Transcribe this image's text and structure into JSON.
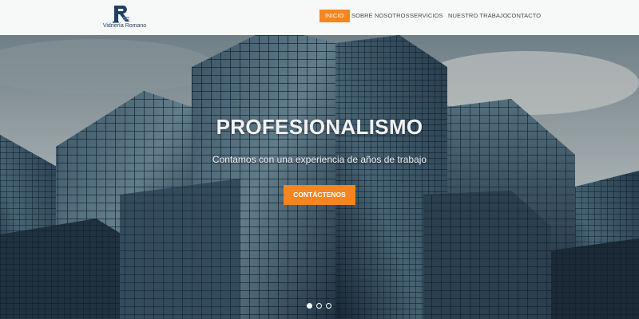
{
  "brand": {
    "logo_name": "Vidriería Romano",
    "logo_mark": "R"
  },
  "nav": {
    "items": [
      {
        "label": "INICIO",
        "active": true
      },
      {
        "label": "SOBRE NOSOTROS",
        "active": false
      },
      {
        "label": "SERVICIOS",
        "active": false
      },
      {
        "label": "NUESTRO TRABAJO",
        "active": false
      },
      {
        "label": "CONTACTO",
        "active": false
      }
    ]
  },
  "hero": {
    "title": "PROFESIONALISMO",
    "subtitle": "Contamos con una experiencia de años de trabajo",
    "button_label": "CONTÁCTENOS",
    "slides_total": 3,
    "active_slide": 1
  },
  "colors": {
    "accent": "#f7851e",
    "brand_blue": "#1f3f66"
  }
}
